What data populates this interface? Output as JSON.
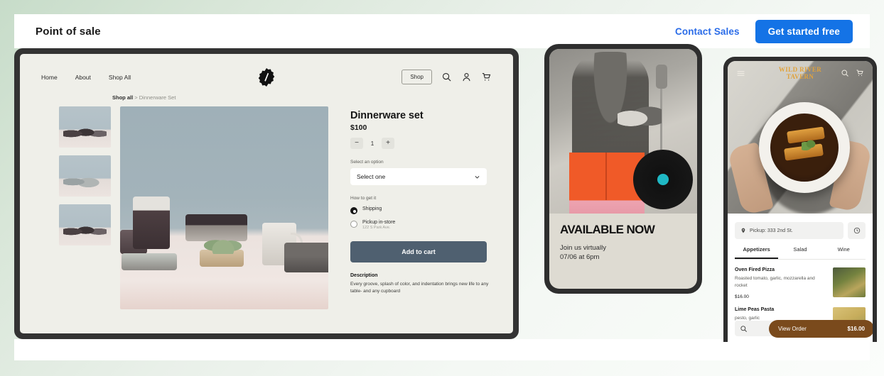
{
  "topbar": {
    "title": "Point of sale",
    "contact_label": "Contact Sales",
    "cta_label": "Get started free",
    "accent_color": "#1473e6"
  },
  "store": {
    "nav": [
      {
        "label": "Home"
      },
      {
        "label": "About"
      },
      {
        "label": "Shop All"
      }
    ],
    "logo_icon": "badge-logo-icon",
    "shop_button": "Shop",
    "icons": [
      "search-icon",
      "account-icon",
      "cart-icon"
    ],
    "breadcrumb": {
      "root": "Shop all",
      "separator": ">",
      "current": "Dinnerware Set"
    },
    "product": {
      "title": "Dinnerware set",
      "price": "$100",
      "qty_minus": "−",
      "qty_value": "1",
      "qty_plus": "+",
      "option_label": "Select an option",
      "option_value": "Select one",
      "fulfillment_label": "How to get it",
      "shipping_label": "Shipping",
      "pickup_label": "Pickup in-store",
      "pickup_address": "122 S Park Ave.",
      "add_to_cart": "Add to cart",
      "description_heading": "Description",
      "description_body": "Every groove, splash of color, and indentation brings new life to any table- and any cupboard"
    }
  },
  "phone_event": {
    "headline": "AVAILABLE NOW",
    "subline_1": "Join us virtually",
    "subline_2": "07/06 at 6pm"
  },
  "phone_restaurant": {
    "menu_icon": "hamburger-menu-icon",
    "logo_line1": "WILD RIVER",
    "logo_line2": "TAVERN",
    "logo_color": "#e0a23c",
    "header_icons": [
      "search-icon",
      "cart-icon"
    ],
    "pickup_text": "Pickup: 333 2nd St.",
    "pickup_icon": "location-pin-icon",
    "clock_icon": "clock-icon",
    "tabs": [
      {
        "label": "Appetizers",
        "active": true
      },
      {
        "label": "Salad",
        "active": false
      },
      {
        "label": "Wine",
        "active": false
      }
    ],
    "items": [
      {
        "name": "Oven Fired Pizza",
        "description": "Roasted tomato, garlic, mozzarella and rocket",
        "price": "$16.00"
      },
      {
        "name": "Lime Peas Pasta",
        "description": "pesto, garlic",
        "price": ""
      }
    ],
    "search_icon": "search-icon",
    "view_order_label": "View Order",
    "view_order_total": "$16.00",
    "view_order_color": "#7a4a1c"
  }
}
